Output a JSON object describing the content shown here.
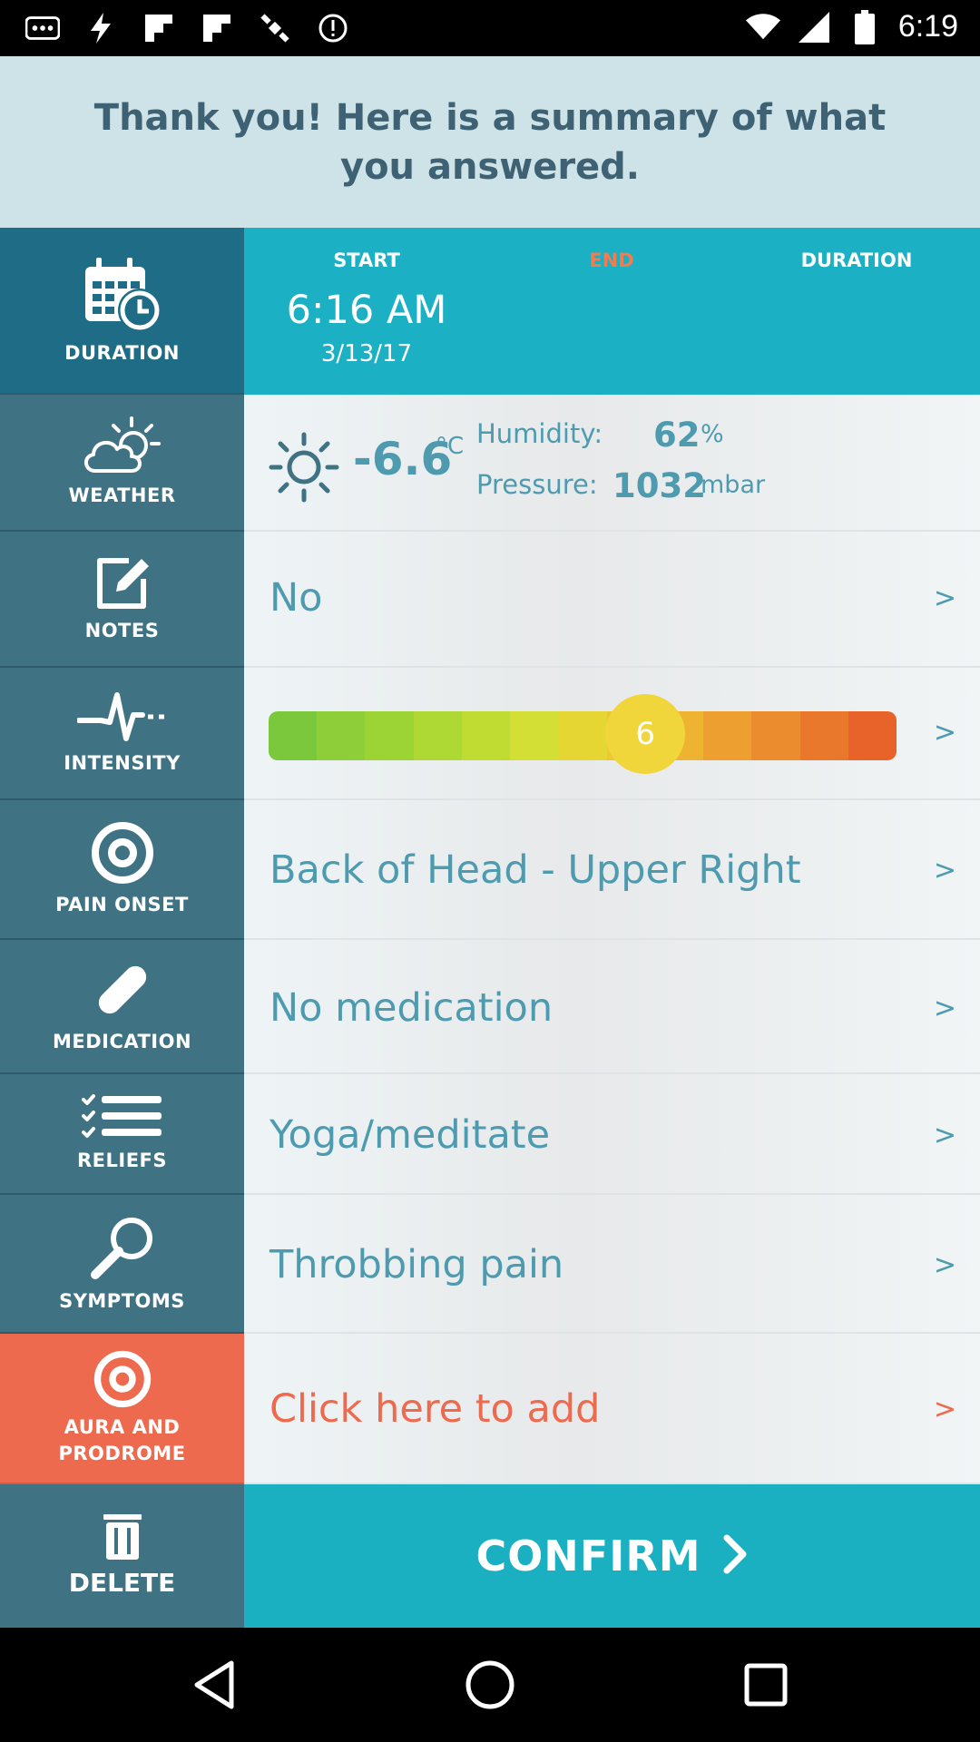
{
  "status_bar": {
    "time": "6:19",
    "icons": [
      "more-icon",
      "lightning-icon",
      "flipboard-icon",
      "flipboard-icon",
      "satellite-icon",
      "alert-icon",
      "wifi-icon",
      "signal-icon",
      "battery-icon"
    ]
  },
  "header": {
    "title": "Thank you! Here is a summary of what you answered."
  },
  "duration": {
    "label": "DURATION",
    "start_header": "START",
    "end_header": "END",
    "duration_header": "DURATION",
    "start_time": "6:16 AM",
    "start_date": "3/13/17",
    "end_color": "#f07c50"
  },
  "weather": {
    "label": "WEATHER",
    "temperature": "-6.6",
    "temp_unit": "°C",
    "humidity_label": "Humidity:",
    "humidity_value": "62",
    "humidity_unit": "%",
    "pressure_label": "Pressure:",
    "pressure_value": "1032",
    "pressure_unit": "mbar"
  },
  "notes": {
    "label": "NOTES",
    "value": "No",
    "chevron": ">"
  },
  "intensity": {
    "label": "INTENSITY",
    "value": "6",
    "level_fraction": 0.6,
    "scale_colors": [
      "#7cc83c",
      "#8ecf39",
      "#9dd435",
      "#aed834",
      "#c0dc33",
      "#d3df34",
      "#e6d634",
      "#edc632",
      "#edb331",
      "#eda030",
      "#eb8c2e",
      "#e9772c",
      "#e8632a"
    ],
    "chevron": ">"
  },
  "pain_onset": {
    "label": "PAIN ONSET",
    "value": "Back of Head - Upper Right",
    "chevron": ">"
  },
  "medication": {
    "label": "MEDICATION",
    "value": "No medication",
    "chevron": ">"
  },
  "reliefs": {
    "label": "RELIEFS",
    "value": "Yoga/meditate",
    "chevron": ">"
  },
  "symptoms": {
    "label": "SYMPTOMS",
    "value": "Throbbing pain",
    "chevron": ">"
  },
  "aura": {
    "label_line1": "AURA AND",
    "label_line2": "PRODROME",
    "value": "Click here to add",
    "chevron": ">",
    "accent": "#ee6a4f"
  },
  "actions": {
    "delete_label": "DELETE",
    "confirm_label": "CONFIRM"
  },
  "colors": {
    "sidebar": "#3f7283",
    "teal": "#1bb0c4",
    "text_blue": "#4e9bb0"
  }
}
